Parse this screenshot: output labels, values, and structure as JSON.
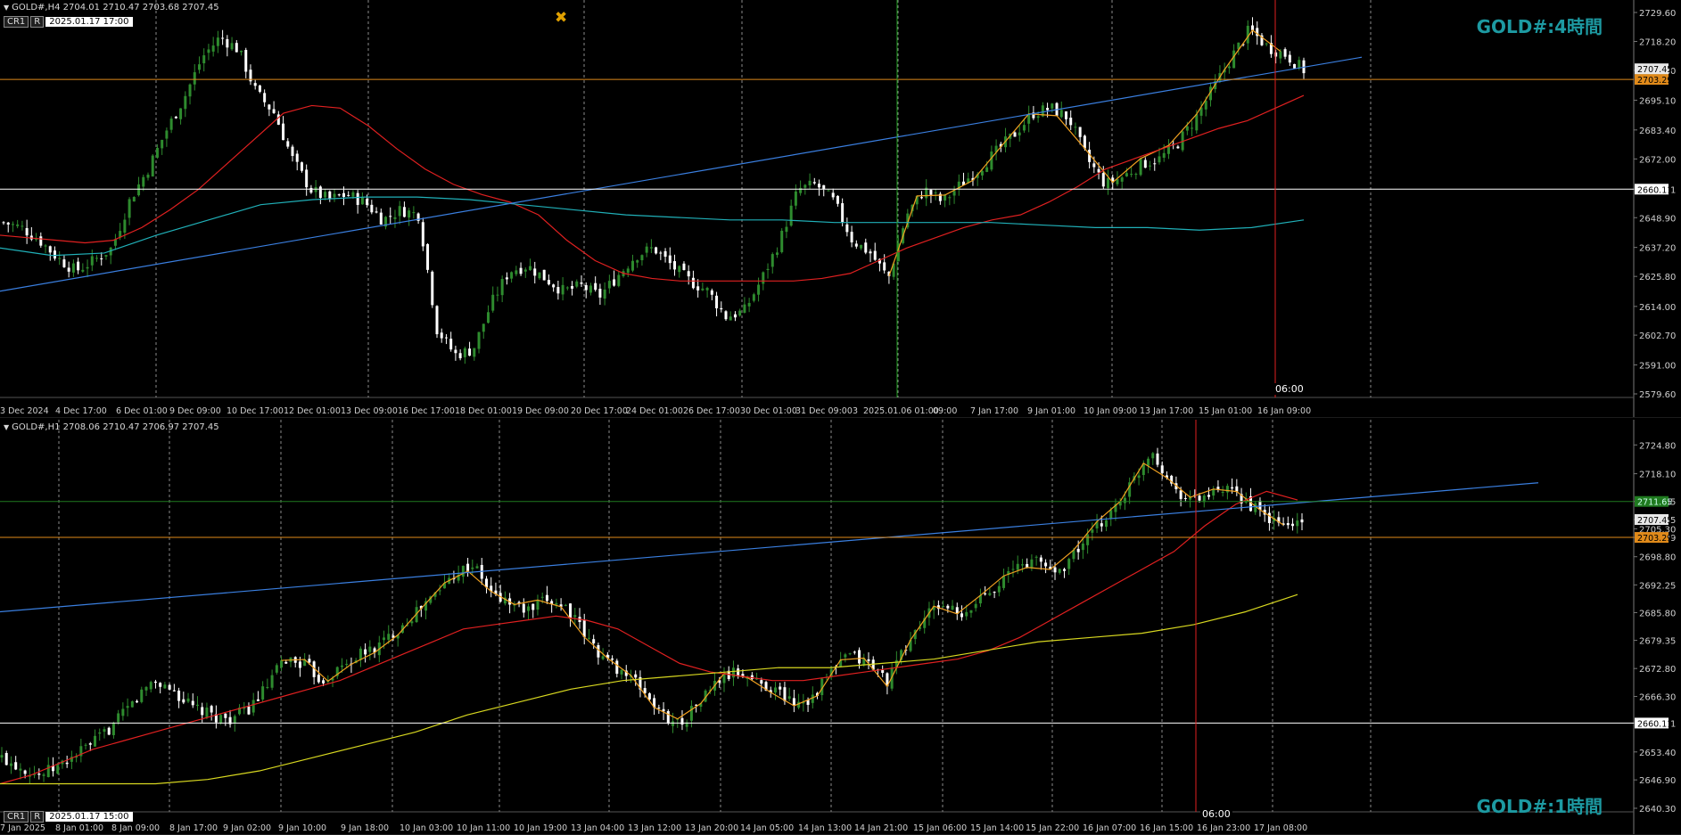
{
  "pane1": {
    "symbol_info": "GOLD#,H4  2704.01 2710.47 2703.68 2707.45",
    "header_box1": "CR1",
    "header_box2": "R",
    "date_tag": "2025.01.17 17:00",
    "title": "GOLD#:4時間",
    "time_marker": "06:00",
    "y_ticks": [
      "2729.60",
      "2718.20",
      "2706.80",
      "2695.10",
      "2683.40",
      "2672.00",
      "2660.11",
      "2648.90",
      "2637.20",
      "2625.80",
      "2614.00",
      "2602.70",
      "2591.00",
      "2579.60"
    ],
    "x_ticks": [
      "3 Dec 2024",
      "4 Dec 17:00",
      "6 Dec 01:00",
      "9 Dec 09:00",
      "10 Dec 17:00",
      "12 Dec 01:00",
      "13 Dec 09:00",
      "16 Dec 17:00",
      "18 Dec 01:00",
      "19 Dec 09:00",
      "20 Dec 17:00",
      "24 Dec 01:00",
      "26 Dec 17:00",
      "30 Dec 01:00",
      "31 Dec 09:00",
      "3",
      "2025.01.06 01:00",
      "09:00",
      "7 Jan 17:00",
      "9 Jan 01:00",
      "10 Jan 09:00",
      "13 Jan 17:00",
      "15 Jan 01:00",
      "16 Jan 09:00"
    ],
    "price_labels": {
      "white_hline": "2660.11",
      "orange_hline": "2703.29",
      "last_price": "2707.45"
    }
  },
  "pane2": {
    "symbol_info": "GOLD#,H1  2708.06 2710.47 2706.97 2707.45",
    "header_box1": "CR1",
    "header_box2": "R",
    "date_tag": "2025.01.17 15:00",
    "title": "GOLD#:1時間",
    "time_marker": "06:00",
    "y_ticks": [
      "2724.80",
      "2718.10",
      "2711.65",
      "2707.45",
      "2705.30",
      "2703.29",
      "2698.80",
      "2692.25",
      "2685.80",
      "2679.35",
      "2672.80",
      "2666.30",
      "2660.11",
      "2653.40",
      "2646.90",
      "2640.30"
    ],
    "x_ticks": [
      "7 Jan 2025",
      "8 Jan 01:00",
      "8 Jan 09:00",
      "8 Jan 17:00",
      "9 Jan 02:00",
      "9 Jan 10:00",
      "9 Jan 18:00",
      "10 Jan 03:00",
      "10 Jan 11:00",
      "10 Jan 19:00",
      "13 Jan 04:00",
      "13 Jan 12:00",
      "13 Jan 20:00",
      "14 Jan 05:00",
      "14 Jan 13:00",
      "14 Jan 21:00",
      "15 Jan 06:00",
      "15 Jan 14:00",
      "15 Jan 22:00",
      "16 Jan 07:00",
      "16 Jan 15:00",
      "16 Jan 23:00",
      "17 Jan 08:00"
    ],
    "price_labels": {
      "white_hline": "2660.11",
      "orange_hline": "2703.29",
      "green_hline": "2711.65",
      "last_price": "2707.45"
    }
  },
  "colors": {
    "background": "#000000",
    "bull": "#2e8b2e",
    "bear": "#ffffff",
    "ma_red": "#e02020",
    "ma_cyan": "#20b0b8",
    "ma_yellow": "#d8d820",
    "trend_blue": "#3a7fe0",
    "zigzag": "#f0a020",
    "orange_line": "#e08a1a",
    "title_teal": "#1d9aa2"
  },
  "chart_data": [
    {
      "type": "candlestick",
      "title": "GOLD#:4時間",
      "ylim": [
        2579.6,
        2729.6
      ],
      "close_path": [
        2647,
        2645,
        2640,
        2633,
        2628,
        2632,
        2637,
        2656,
        2668,
        2683,
        2696,
        2712,
        2720,
        2715,
        2698,
        2690,
        2672,
        2660,
        2656,
        2658,
        2655,
        2648,
        2652,
        2650,
        2605,
        2595,
        2597,
        2615,
        2628,
        2630,
        2625,
        2620,
        2622,
        2618,
        2626,
        2634,
        2637,
        2630,
        2624,
        2620,
        2610,
        2612,
        2625,
        2640,
        2660,
        2662,
        2655,
        2640,
        2635,
        2625,
        2650,
        2660,
        2655,
        2662,
        2668,
        2675,
        2682,
        2690,
        2692,
        2688,
        2672,
        2662,
        2665,
        2670,
        2672,
        2678,
        2688,
        2700,
        2712,
        2723,
        2716,
        2713,
        2707
      ],
      "horizontal_lines": [
        2660.11,
        2703.29
      ],
      "series": [
        {
          "name": "",
          "values": [
            2642,
            2641,
            2640,
            2639,
            2640,
            2645,
            2652,
            2660,
            2670,
            2680,
            2690,
            2693,
            2692,
            2685,
            2676,
            2668,
            2662,
            2658,
            2655,
            2650,
            2640,
            2632,
            2627,
            2625,
            2624,
            2624,
            2624,
            2624,
            2624,
            2625,
            2627,
            2632,
            2637,
            2641,
            2645,
            2648,
            2650,
            2655,
            2661,
            2668,
            2672,
            2676,
            2680,
            2684,
            2687,
            2692,
            2697
          ]
        },
        {
          "name": "",
          "values": [
            2637,
            2634,
            2635,
            2642,
            2648,
            2654,
            2656,
            2657,
            2657,
            2656,
            2654,
            2652,
            2650,
            2649,
            2648,
            2648,
            2647,
            2647,
            2647,
            2647,
            2646,
            2645,
            2645,
            2644,
            2645,
            2648
          ]
        }
      ]
    },
    {
      "type": "candlestick",
      "title": "GOLD#:1時間",
      "ylim": [
        2640.3,
        2729.0
      ],
      "close_path": [
        2652,
        2650,
        2648,
        2650,
        2653,
        2656,
        2660,
        2665,
        2670,
        2668,
        2664,
        2662,
        2661,
        2663,
        2668,
        2675,
        2674,
        2670,
        2673,
        2676,
        2678,
        2682,
        2686,
        2690,
        2695,
        2697,
        2690,
        2688,
        2686,
        2689,
        2687,
        2680,
        2675,
        2672,
        2668,
        2662,
        2660,
        2665,
        2670,
        2672,
        2670,
        2668,
        2665,
        2666,
        2672,
        2676,
        2674,
        2670,
        2678,
        2685,
        2688,
        2684,
        2690,
        2693,
        2697,
        2698,
        2695,
        2700,
        2705,
        2710,
        2716,
        2724,
        2716,
        2712,
        2713,
        2714,
        2712,
        2708,
        2706,
        2707
      ],
      "horizontal_lines": [
        2660.11,
        2703.29,
        2711.65
      ],
      "series": [
        {
          "name": "",
          "values": [
            2646,
            2648,
            2651,
            2654,
            2656,
            2658,
            2660,
            2662,
            2664,
            2666,
            2668,
            2670,
            2673,
            2676,
            2679,
            2682,
            2683,
            2684,
            2685,
            2684,
            2682,
            2678,
            2674,
            2672,
            2671,
            2670,
            2670,
            2671,
            2672,
            2673,
            2674,
            2675,
            2677,
            2680,
            2684,
            2688,
            2692,
            2696,
            2700,
            2706,
            2711,
            2714,
            2712
          ]
        },
        {
          "name": "",
          "values": [
            2646,
            2646,
            2646,
            2646,
            2647,
            2649,
            2652,
            2655,
            2658,
            2662,
            2665,
            2668,
            2670,
            2671,
            2672,
            2673,
            2673,
            2674,
            2675,
            2677,
            2679,
            2680,
            2681,
            2683,
            2686,
            2690
          ]
        }
      ]
    }
  ]
}
